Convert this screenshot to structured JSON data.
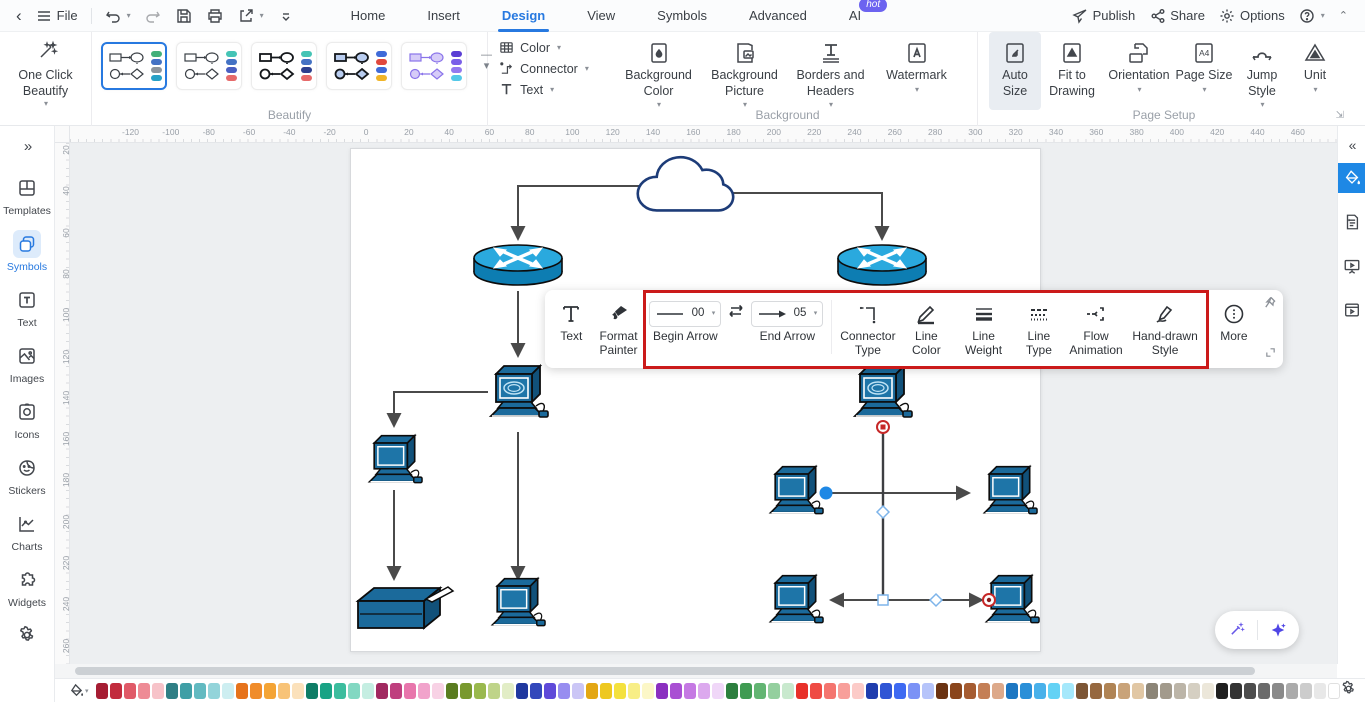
{
  "titlebar": {
    "back_icon": "‹",
    "file_label": "File",
    "tabs": [
      {
        "label": "Home"
      },
      {
        "label": "Insert"
      },
      {
        "label": "Design"
      },
      {
        "label": "View"
      },
      {
        "label": "Symbols"
      },
      {
        "label": "Advanced"
      },
      {
        "label": "AI"
      }
    ],
    "active_tab": "Design",
    "ai_badge": "hot",
    "publish_label": "Publish",
    "share_label": "Share",
    "options_label": "Options"
  },
  "ribbon": {
    "one_click_beautify_label": "One Click Beautify",
    "beautify_group_label": "Beautify",
    "beautify_styles": [
      {
        "selected": true,
        "stroke": "#3a3f45",
        "fill": "#ffffff",
        "pills": [
          "#43b07a",
          "#4472c4",
          "#8d949c",
          "#27a0c6"
        ]
      },
      {
        "selected": false,
        "stroke": "#3a3f45",
        "fill": "#ffffff",
        "pills": [
          "#45c4b5",
          "#4472c4",
          "#4a5fc1",
          "#e66a6a"
        ]
      },
      {
        "selected": false,
        "stroke": "#15181c",
        "fill": "#ffffff",
        "pills": [
          "#45c4b5",
          "#4472c4",
          "#2c3f8f",
          "#e66a6a"
        ]
      },
      {
        "selected": false,
        "stroke": "#15181c",
        "fill": "#b9cdf0",
        "pills": [
          "#3f6ad8",
          "#e0483e",
          "#3f6ad8",
          "#f0b428"
        ]
      },
      {
        "selected": false,
        "stroke": "#8a74ea",
        "fill": "#d6ccf8",
        "pills": [
          "#5b3fd4",
          "#7a5fe8",
          "#9379ef",
          "#54c8e8"
        ]
      }
    ],
    "format_menu": {
      "color": "Color",
      "connector": "Connector",
      "text": "Text"
    },
    "background_group": {
      "label": "Background",
      "color": "Background Color",
      "picture": "Background Picture",
      "borders": "Borders and Headers",
      "watermark": "Watermark"
    },
    "page_setup_group": {
      "label": "Page Setup",
      "auto_size": "Auto Size",
      "fit": "Fit to Drawing",
      "orientation": "Orientation",
      "page_size": "Page Size",
      "jump": "Jump Style",
      "unit": "Unit",
      "active_item": "Auto Size"
    }
  },
  "left_sidebar": {
    "items": [
      {
        "label": "Templates",
        "active": false
      },
      {
        "label": "Symbols",
        "active": true
      },
      {
        "label": "Text",
        "active": false
      },
      {
        "label": "Images",
        "active": false
      },
      {
        "label": "Icons",
        "active": false
      },
      {
        "label": "Stickers",
        "active": false
      },
      {
        "label": "Charts",
        "active": false
      },
      {
        "label": "Widgets",
        "active": false
      }
    ]
  },
  "floating_toolbar": {
    "text_label": "Text",
    "format_painter_label": "Format Painter",
    "begin_arrow": {
      "label": "Begin Arrow",
      "value": "00"
    },
    "end_arrow": {
      "label": "End Arrow",
      "value": "05"
    },
    "connector_type_label": "Connector Type",
    "line_color_label": "Line Color",
    "line_weight_label": "Line Weight",
    "line_type_label": "Line Type",
    "flow_animation_label": "Flow Animation",
    "hand_drawn_label": "Hand-drawn Style",
    "more_label": "More"
  },
  "rulers": {
    "horizontal": [
      -120,
      -100,
      -80,
      -60,
      -40,
      -20,
      0,
      20,
      40,
      60,
      80,
      100,
      120,
      140,
      160,
      180,
      200,
      220,
      240,
      260,
      280,
      300,
      320,
      340,
      360,
      380,
      400,
      420,
      440,
      460
    ],
    "vertical": [
      20,
      40,
      60,
      80,
      100,
      120,
      140,
      160,
      180,
      200,
      220,
      240,
      260
    ]
  },
  "palette": {
    "colors": [
      "#a61d33",
      "#c22b3d",
      "#e05a68",
      "#ee8b95",
      "#f7c3c9",
      "#2f7f85",
      "#3f9fa6",
      "#62bac1",
      "#93d4da",
      "#cdeef1",
      "#e6731c",
      "#f08c2a",
      "#f4a435",
      "#f8c377",
      "#fbe1bb",
      "#0e7d66",
      "#19a385",
      "#3cbd9e",
      "#82d8c2",
      "#c5eee2",
      "#a12960",
      "#bf3f7e",
      "#e876ac",
      "#f1a3cb",
      "#f8d2e5",
      "#5a7c20",
      "#79992e",
      "#9ab94e",
      "#bfd489",
      "#e2edc6",
      "#20389f",
      "#3247bb",
      "#5f4ad9",
      "#978df0",
      "#cbc6f6",
      "#e3a714",
      "#eec81f",
      "#f4e13e",
      "#f8ee86",
      "#fcf7c7",
      "#8b2fc0",
      "#a94fd3",
      "#c579e3",
      "#dca9ee",
      "#f0d7f8",
      "#2c7f3e",
      "#3f9b52",
      "#63b573",
      "#94cf9e",
      "#c9e9ce",
      "#e8312a",
      "#ef4b44",
      "#f4756f",
      "#f89f9a",
      "#fccbc8",
      "#1f3dae",
      "#2f55d5",
      "#3e6af2",
      "#7b92f6",
      "#b6c4fa",
      "#6b3312",
      "#8a451c",
      "#a65c31",
      "#c47f56",
      "#dda98a",
      "#1d77c2",
      "#2a8fd8",
      "#49b1ea",
      "#63d2f5",
      "#a5e8fb",
      "#7d5635",
      "#96683f",
      "#b08455",
      "#c9a379",
      "#e1c7a4",
      "#8c8577",
      "#a29a8c",
      "#bcb5a8",
      "#d5cfc2",
      "#ece7da",
      "#1f1f1f",
      "#333333",
      "#4d4d4d",
      "#6b6b6b",
      "#8a8a8a",
      "#ababab",
      "#cccccc",
      "#e8e8e8",
      "#ffffff"
    ]
  },
  "diagram_colors": {
    "shape_body": "#1b6a9b",
    "shape_dark": "#11517a",
    "router_top": "#2aa9de",
    "router_side": "#0d7db2",
    "connector": "#4a4a4a",
    "cloud_stroke": "#1d3c78",
    "selection_blue": "#1e88e5",
    "selection_red": "#c62828"
  }
}
